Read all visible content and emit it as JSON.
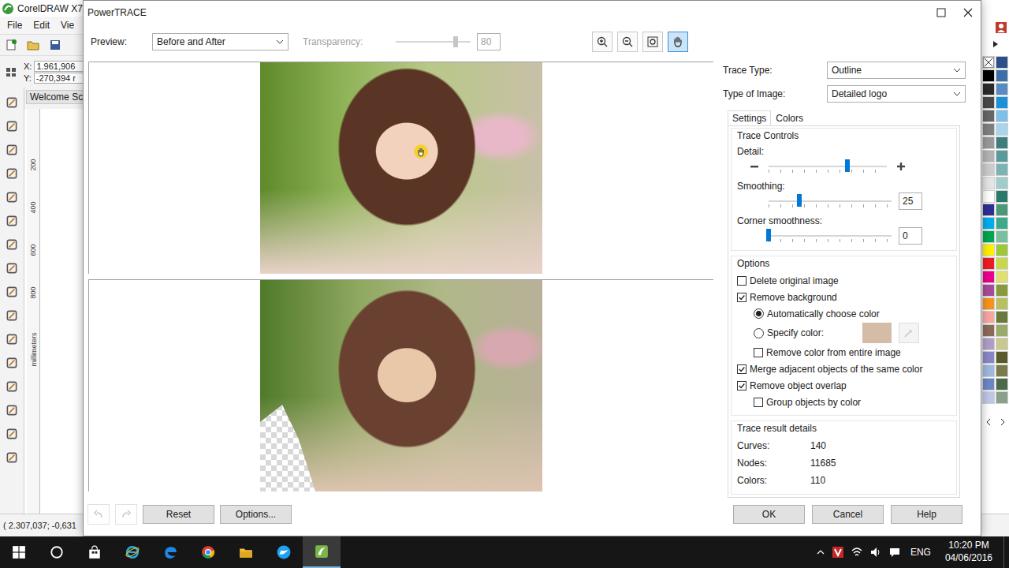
{
  "app": {
    "title": "CorelDRAW X7",
    "menu": [
      "File",
      "Edit",
      "Vie"
    ],
    "coords": [
      {
        "axis": "X:",
        "value": "1.961,906"
      },
      {
        "axis": "Y:",
        "value": "-270,394 r"
      }
    ],
    "doc_tab": "Welcome Sc",
    "ruler_unit": "millimeters",
    "ruler_ticks": [
      "200",
      "400",
      "600",
      "800"
    ],
    "status": "( 2.307,037; -0,631",
    "palette": [
      {
        "color": "#2a4f8a"
      },
      {
        "color": "#000000"
      },
      {
        "color": "#3c6ea8"
      },
      {
        "color": "#2b2b2b"
      },
      {
        "color": "#5a8ac4"
      },
      {
        "color": "#4a4a4a"
      },
      {
        "color": "#1a90d8"
      },
      {
        "color": "#666666"
      },
      {
        "color": "#7ec0ea"
      },
      {
        "color": "#808080"
      },
      {
        "color": "#a8d4ee"
      },
      {
        "color": "#999999"
      },
      {
        "color": "#3d7d7d"
      },
      {
        "color": "#b3b3b3"
      },
      {
        "color": "#5a9a9a"
      },
      {
        "color": "#cccccc"
      },
      {
        "color": "#7ab4b4"
      },
      {
        "color": "#e6e6e6"
      },
      {
        "color": "#a0cccc"
      },
      {
        "color": "#ffffff"
      },
      {
        "color": "#2a7a6a"
      },
      {
        "color": "#2e3192"
      },
      {
        "color": "#4a9a7a"
      },
      {
        "color": "#00aeef"
      },
      {
        "color": "#3aaa8a"
      },
      {
        "color": "#00a651"
      },
      {
        "color": "#7ac0a0"
      },
      {
        "color": "#fff200"
      },
      {
        "color": "#9cc83a"
      },
      {
        "color": "#ed1c24"
      },
      {
        "color": "#c8d84a"
      },
      {
        "color": "#ec008c"
      },
      {
        "color": "#e0e070"
      },
      {
        "color": "#a84c9c"
      },
      {
        "color": "#8a9a3a"
      },
      {
        "color": "#f7941d"
      },
      {
        "color": "#b8c060"
      },
      {
        "color": "#f9a8a0"
      },
      {
        "color": "#6a7a3a"
      },
      {
        "color": "#8c6b5a"
      },
      {
        "color": "#9aaa6a"
      },
      {
        "color": "#b0a0c8"
      },
      {
        "color": "#c8c890"
      },
      {
        "color": "#8888c8"
      },
      {
        "color": "#5a5a2a"
      },
      {
        "color": "#a0b8e0"
      },
      {
        "color": "#7a7a4a"
      },
      {
        "color": "#6a88c8"
      },
      {
        "color": "#4a6a4a"
      },
      {
        "color": "#c0c8e8"
      },
      {
        "color": "#8aa08a"
      }
    ]
  },
  "dialog": {
    "title": "PowerTRACE",
    "preview": {
      "label": "Preview:",
      "value": "Before and After"
    },
    "transparency": {
      "label": "Transparency:",
      "value": "80",
      "level": 0.8,
      "disabled": true
    },
    "view_tools": [
      {
        "kind": "zoom-in",
        "selected": false
      },
      {
        "kind": "zoom-out",
        "selected": false
      },
      {
        "kind": "fit",
        "selected": false
      },
      {
        "kind": "pan",
        "selected": true
      }
    ],
    "trace_type": {
      "label": "Trace Type:",
      "value": "Outline"
    },
    "image_type": {
      "label": "Type of Image:",
      "value": "Detailed logo"
    },
    "tabs": [
      {
        "label": "Settings",
        "selected": true
      },
      {
        "label": "Colors",
        "selected": false
      }
    ],
    "controls": {
      "title": "Trace Controls",
      "sliders": [
        {
          "label": "Detail:",
          "kind": "detail",
          "level": 0.667
        },
        {
          "label": "Smoothing:",
          "kind": "value",
          "value": "25",
          "level": 0.25
        },
        {
          "label": "Corner smoothness:",
          "kind": "value",
          "value": "0",
          "level": 0
        }
      ]
    },
    "options": {
      "title": "Options",
      "items": [
        {
          "label": "Delete original image",
          "kind": "checkbox",
          "checked": false,
          "indent": false
        },
        {
          "label": "Remove background",
          "kind": "checkbox",
          "checked": true,
          "indent": false
        },
        {
          "label": "Automatically choose color",
          "kind": "radio",
          "selected": true,
          "indent": true
        },
        {
          "label": "Specify color:",
          "kind": "radio-color",
          "selected": false,
          "indent": true,
          "color": "#d4bca6"
        },
        {
          "label": "Remove color from entire image",
          "kind": "checkbox",
          "checked": false,
          "indent": true
        },
        {
          "label": "Merge adjacent objects of the same color",
          "kind": "checkbox",
          "checked": true,
          "indent": false
        },
        {
          "label": "Remove object overlap",
          "kind": "checkbox",
          "checked": true,
          "indent": false
        },
        {
          "label": "Group objects by color",
          "kind": "checkbox",
          "checked": false,
          "indent": true
        }
      ]
    },
    "results": {
      "title": "Trace result details",
      "rows": [
        {
          "label": "Curves:",
          "value": "140"
        },
        {
          "label": "Nodes:",
          "value": "11685"
        },
        {
          "label": "Colors:",
          "value": "110"
        }
      ]
    },
    "history": [
      {
        "kind": "undo",
        "disabled": true
      },
      {
        "kind": "redo",
        "disabled": true
      }
    ],
    "left_buttons": [
      "Reset",
      "Options..."
    ],
    "right_buttons": [
      "OK",
      "Cancel",
      "Help"
    ]
  },
  "taskbar": {
    "apps": [
      {
        "kind": "store",
        "active": false
      },
      {
        "kind": "ie",
        "active": false
      },
      {
        "kind": "edge",
        "active": false
      },
      {
        "kind": "chrome",
        "active": false
      },
      {
        "kind": "explorer",
        "active": false
      },
      {
        "kind": "bird",
        "active": false
      },
      {
        "kind": "corel",
        "active": true
      }
    ],
    "lang": "ENG",
    "time": "10:20 PM",
    "date": "04/06/2016"
  }
}
